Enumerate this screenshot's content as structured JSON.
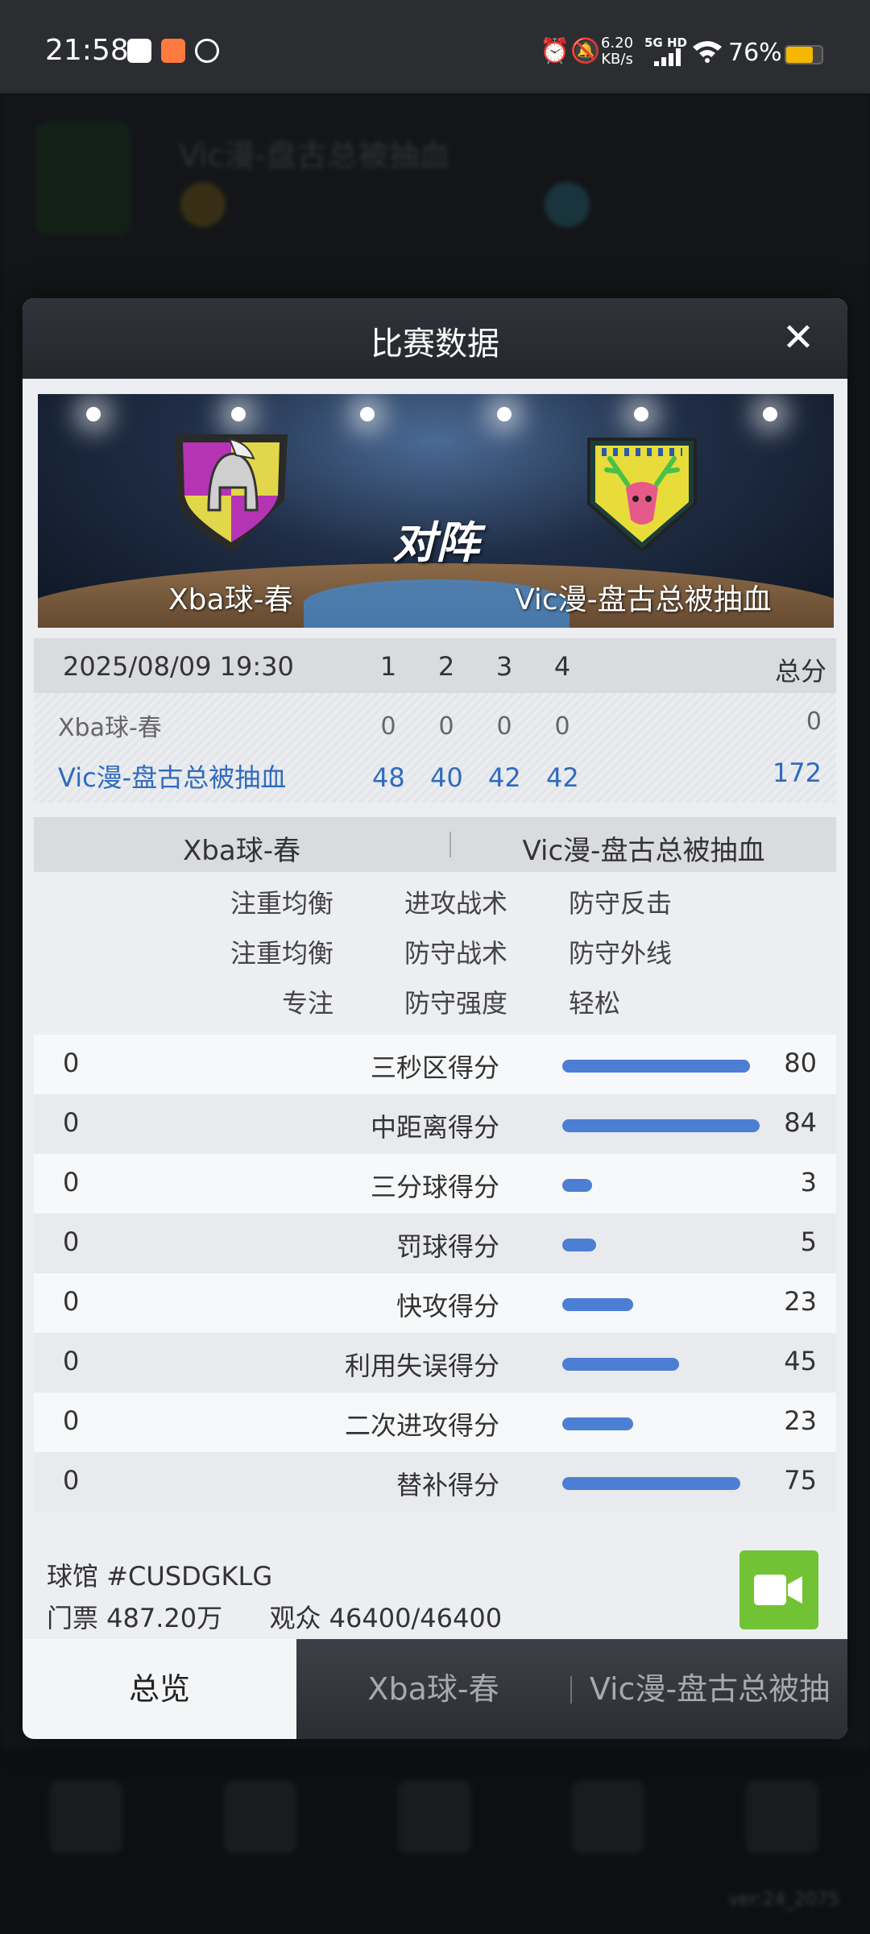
{
  "status_bar": {
    "time": "21:58",
    "net_speed": "6.20",
    "net_speed_unit": "KB/s",
    "network": "5G HD",
    "battery": "76%",
    "battery_color": "#f5b800"
  },
  "background": {
    "team_title": "Vic漫-盘古总被抽血",
    "version": "ver:24_2075"
  },
  "modal": {
    "title": "比赛数据",
    "close_icon": "close-icon",
    "banner": {
      "away_team": "Xba球-春",
      "home_team": "Vic漫-盘古总被抽血",
      "vs_label": "对阵"
    },
    "scoreboard": {
      "datetime": "2025/08/09 19:30",
      "quarters": [
        "1",
        "2",
        "3",
        "4"
      ],
      "total_label": "总分",
      "rows": [
        {
          "team": "Xba球-春",
          "q": [
            "0",
            "0",
            "0",
            "0"
          ],
          "total": "0"
        },
        {
          "team": "Vic漫-盘古总被抽血",
          "q": [
            "48",
            "40",
            "42",
            "42"
          ],
          "total": "172"
        }
      ]
    },
    "tactics": {
      "away_team": "Xba球-春",
      "home_team": "Vic漫-盘古总被抽血",
      "rows": [
        {
          "left": "注重均衡",
          "mid": "进攻战术",
          "right": "防守反击"
        },
        {
          "left": "注重均衡",
          "mid": "防守战术",
          "right": "防守外线"
        },
        {
          "left": "专注",
          "mid": "防守强度",
          "right": "轻松"
        }
      ]
    },
    "stats": [
      {
        "label": "三秒区得分",
        "away": "0",
        "home": "80",
        "fraction": 0.95
      },
      {
        "label": "中距离得分",
        "away": "0",
        "home": "84",
        "fraction": 1.0
      },
      {
        "label": "三分球得分",
        "away": "0",
        "home": "3",
        "fraction": 0.15
      },
      {
        "label": "罚球得分",
        "away": "0",
        "home": "5",
        "fraction": 0.17
      },
      {
        "label": "快攻得分",
        "away": "0",
        "home": "23",
        "fraction": 0.36
      },
      {
        "label": "利用失误得分",
        "away": "0",
        "home": "45",
        "fraction": 0.59
      },
      {
        "label": "二次进攻得分",
        "away": "0",
        "home": "23",
        "fraction": 0.36
      },
      {
        "label": "替补得分",
        "away": "0",
        "home": "75",
        "fraction": 0.9
      }
    ],
    "info": {
      "arena": "球馆 #CUSDGKLG",
      "tickets": "门票 487.20万",
      "attendance": "观众 46400/46400"
    },
    "tabs": [
      "总览",
      "Xba球-春",
      "Vic漫-盘古总被抽"
    ],
    "stat_bar_color": "#4c7fd4",
    "video_button_color": "#72c235"
  }
}
